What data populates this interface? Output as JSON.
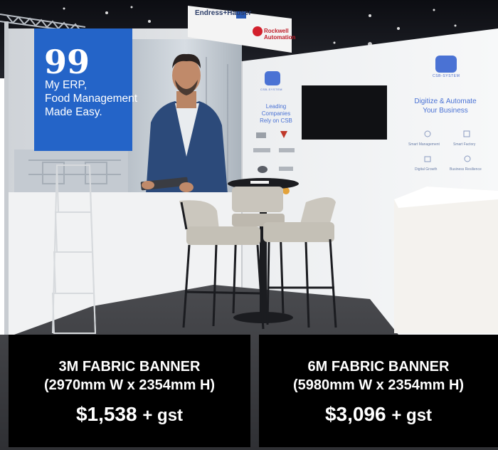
{
  "booth": {
    "quote_banner": {
      "mark": "99",
      "lines": [
        "My ERP,",
        "Food Management",
        "Made Easy."
      ]
    },
    "ceiling_sign": {
      "left_brand": "Endress+Hauser",
      "right_brand": "Rockwell Automation"
    },
    "wall": {
      "logo_small_caption": "CSB-SYSTEM",
      "logo_large_caption": "CSB-SYSTEM",
      "leading_lines": [
        "Leading Companies",
        "Rely on CSB"
      ],
      "headline_lines": [
        "Digitize & Automate",
        "Your Business"
      ],
      "features": [
        "Smart Management",
        "Smart Factory",
        "Digital Growth",
        "Business Resilience"
      ]
    }
  },
  "offers": [
    {
      "title": "3M FABRIC BANNER",
      "size": "(2970mm W x 2354mm H)",
      "price": "$1,538",
      "tax": "+ gst"
    },
    {
      "title": "6M FABRIC BANNER",
      "size": "(5980mm W x 2354mm H)",
      "price": "$3,096",
      "tax": "+ gst"
    }
  ],
  "colors": {
    "panel_background": "#000000",
    "panel_text": "#ffffff",
    "banner_blue": "#2464c8",
    "brand_blue": "#4a72d4"
  }
}
